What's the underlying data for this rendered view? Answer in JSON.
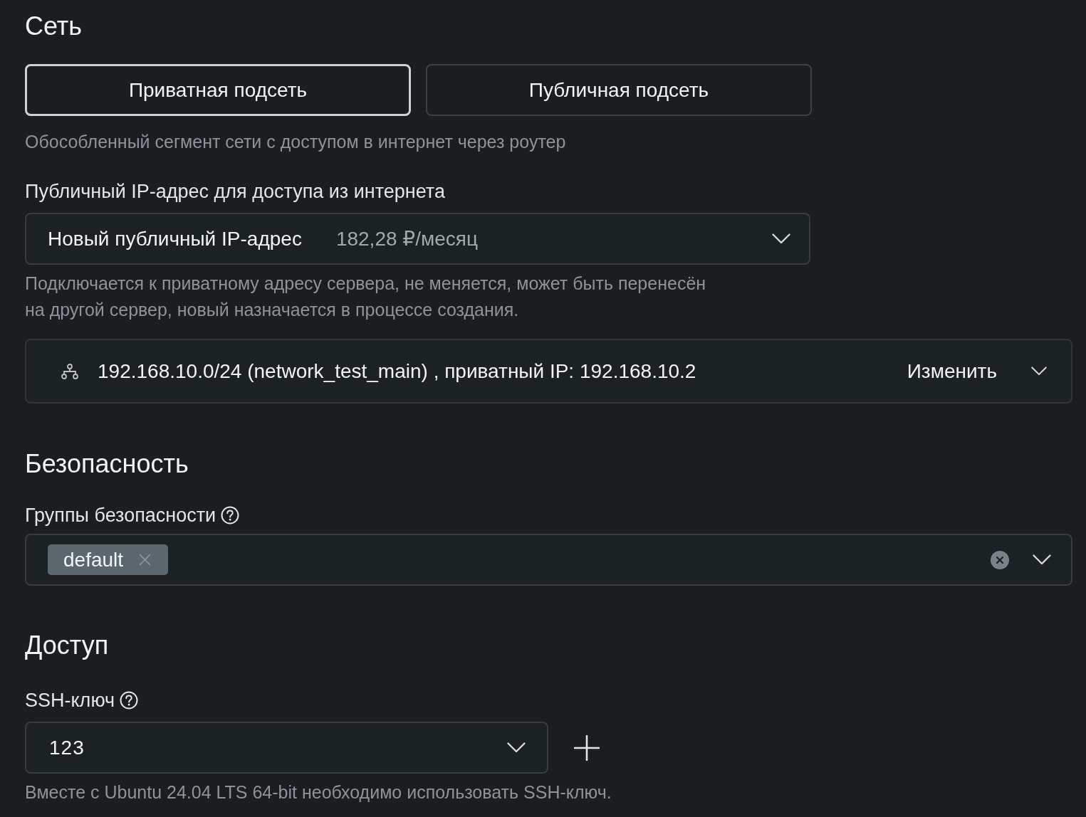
{
  "network": {
    "title": "Сеть",
    "subnet_types": [
      {
        "label": "Приватная подсеть",
        "selected": true
      },
      {
        "label": "Публичная подсеть",
        "selected": false
      }
    ],
    "subnet_hint": "Обособленный сегмент сети с доступом в интернет через роутер",
    "public_ip": {
      "label": "Публичный IP-адрес для доступа из интернета",
      "value": "Новый публичный IP-адрес",
      "price": "182,28 ₽/месяц",
      "hint": "Подключается к приватному адресу сервера, не меняется, может быть перенесён на другой сервер, новый назначается в процессе создания."
    },
    "private_network": {
      "value": "192.168.10.0/24 (network_test_main) , приватный IP: 192.168.10.2",
      "action": "Изменить"
    }
  },
  "security": {
    "title": "Безопасность",
    "groups": {
      "label": "Группы безопасности",
      "tags": [
        {
          "label": "default"
        }
      ]
    }
  },
  "access": {
    "title": "Доступ",
    "ssh_key": {
      "label": "SSH-ключ",
      "value": "123",
      "hint": "Вместе с Ubuntu 24.04 LTS 64-bit необходимо использовать SSH-ключ."
    }
  }
}
